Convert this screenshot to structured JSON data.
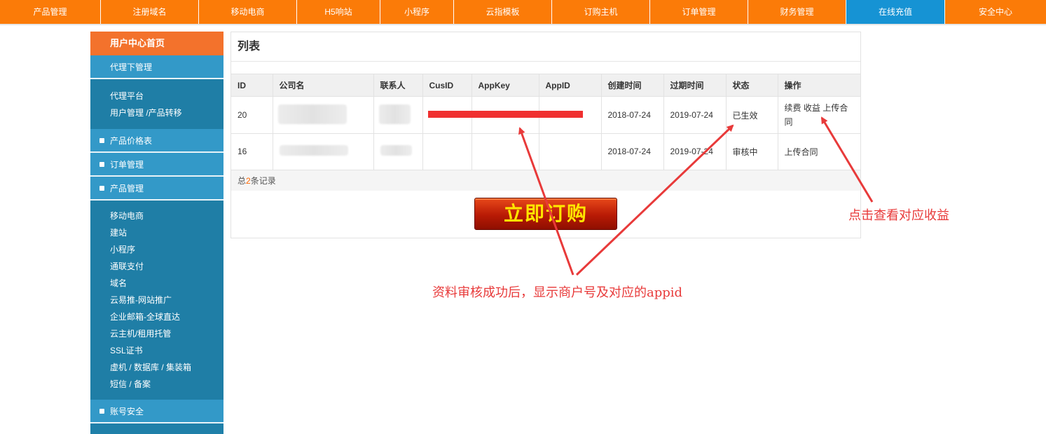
{
  "topnav": {
    "items": [
      "产品管理",
      "注册域名",
      "移动电商",
      "H5响站",
      "小程序",
      "云指模板",
      "订购主机",
      "订单管理",
      "财务管理",
      "在线充值",
      "安全中心"
    ],
    "active_index": 9
  },
  "sidebar": {
    "home": "用户中心首页",
    "agent_head": "代理下管理",
    "agent_links": [
      "代理平台",
      "用户管理 /产品转移"
    ],
    "price_list": "产品价格表",
    "order_mgmt": "订单管理",
    "product_mgmt": "产品管理",
    "product_links": [
      "移动电商",
      "建站",
      "小程序",
      "通联支付",
      "域名",
      "云易推-网站推广",
      "企业邮箱-全球直达",
      "云主机/租用托管",
      "SSL证书",
      "虚机 / 数据库 / 集装箱",
      "短信 / 备案"
    ],
    "account_security": "账号安全"
  },
  "panel": {
    "title": "列表",
    "columns": [
      "ID",
      "公司名",
      "联系人",
      "CusID",
      "AppKey",
      "AppID",
      "创建时间",
      "过期时间",
      "状态",
      "操作"
    ],
    "rows": [
      {
        "id": "20",
        "created": "2018-07-24",
        "expires": "2019-07-24",
        "status": "已生效",
        "actions": [
          "续费",
          "收益",
          "上传合同"
        ]
      },
      {
        "id": "16",
        "created": "2018-07-24",
        "expires": "2019-07-24",
        "status": "审核中",
        "actions": [
          "上传合同"
        ]
      }
    ],
    "total_prefix": "总",
    "total_count": "2",
    "total_suffix": "条记录",
    "order_button": "立即订购"
  },
  "annotations": {
    "appid_note": "资料审核成功后，显示商户号及对应的appid",
    "earnings_note": "点击查看对应收益",
    "color": "#e83a3a"
  }
}
